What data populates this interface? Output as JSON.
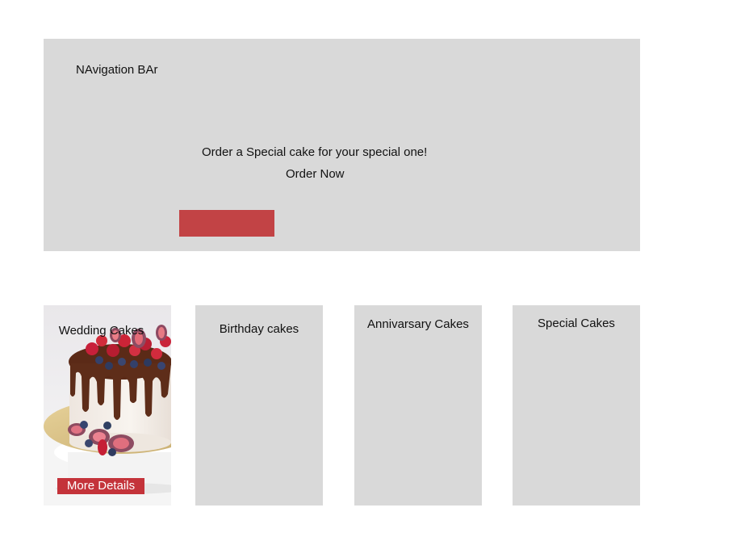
{
  "hero": {
    "nav_label": "NAvigation BAr",
    "tagline": "Order a Special cake for your special one!",
    "order_now": "Order Now",
    "button_color": "#c24345"
  },
  "cards": [
    {
      "title": "Wedding Cakes",
      "image": "cake-photo",
      "action_label": "More Details"
    },
    {
      "title": "Birthday cakes"
    },
    {
      "title": "Annivarsary Cakes"
    },
    {
      "title": "Special Cakes"
    }
  ],
  "colors": {
    "panel": "#d9d9d9",
    "accent": "#c4333a",
    "background": "#ffffff"
  }
}
